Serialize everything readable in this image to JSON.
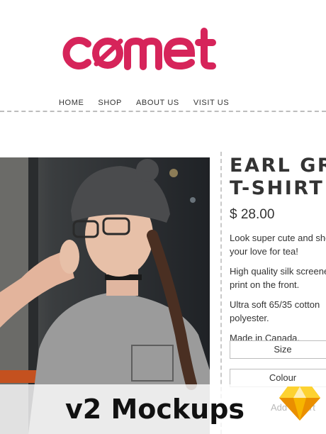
{
  "brand": {
    "name": "comet",
    "color": "#d6245a"
  },
  "nav": {
    "items": [
      "HOME",
      "SHOP",
      "ABOUT US",
      "VISIT US"
    ]
  },
  "product": {
    "title_line1": "EARL GREY",
    "title_line2": "T-SHIRT",
    "price": "$ 28.00",
    "desc1": "Look super cute and show",
    "desc1b": "your love for tea!",
    "desc2": "High quality silk screened",
    "desc2b": "print on the front.",
    "desc3": "Ultra soft 65/35 cotton",
    "desc3b": "polyester.",
    "desc4": "Made in Canada.",
    "size_label": "Size",
    "colour_label": "Colour",
    "cart_label": "Add to cart"
  },
  "banner": {
    "text": "v2 Mockups",
    "icon": "sketch-diamond-icon"
  }
}
